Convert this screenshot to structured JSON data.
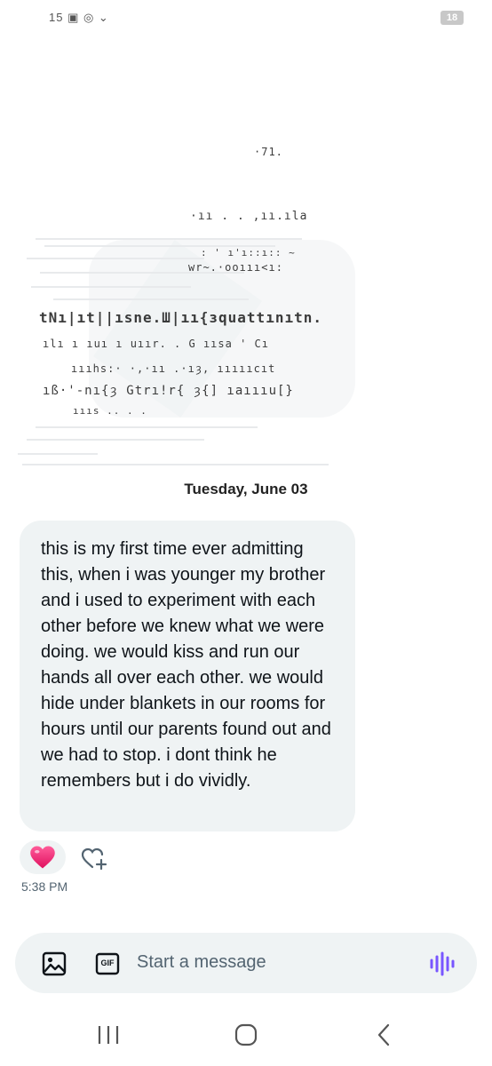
{
  "status_bar": {
    "left_icons": "15 ▣ ◎ ⌄",
    "battery": "18"
  },
  "conversation": {
    "date_separator": "Tuesday, June 03",
    "message": {
      "text": "this is my first time ever admitting this, when i was younger my brother and i used to experiment with each other before we knew what we were doing. we would kiss and run our hands all over each other. we would hide under blankets in our rooms for hours until our parents found out and we had to stop. i dont think he remembers but i do vividly.",
      "time": "5:38 PM",
      "reaction": "heart"
    }
  },
  "composer": {
    "placeholder": "Start a message",
    "icons": [
      "image-icon",
      "gif-icon",
      "voice-icon"
    ],
    "gif_label": "GIF"
  },
  "nav_bar": {
    "icons": [
      "recents-icon",
      "home-icon",
      "back-icon"
    ]
  },
  "colors": {
    "bubble": "#eff3f4",
    "accent_purple": "#7856ff",
    "heart": "#f91880"
  }
}
